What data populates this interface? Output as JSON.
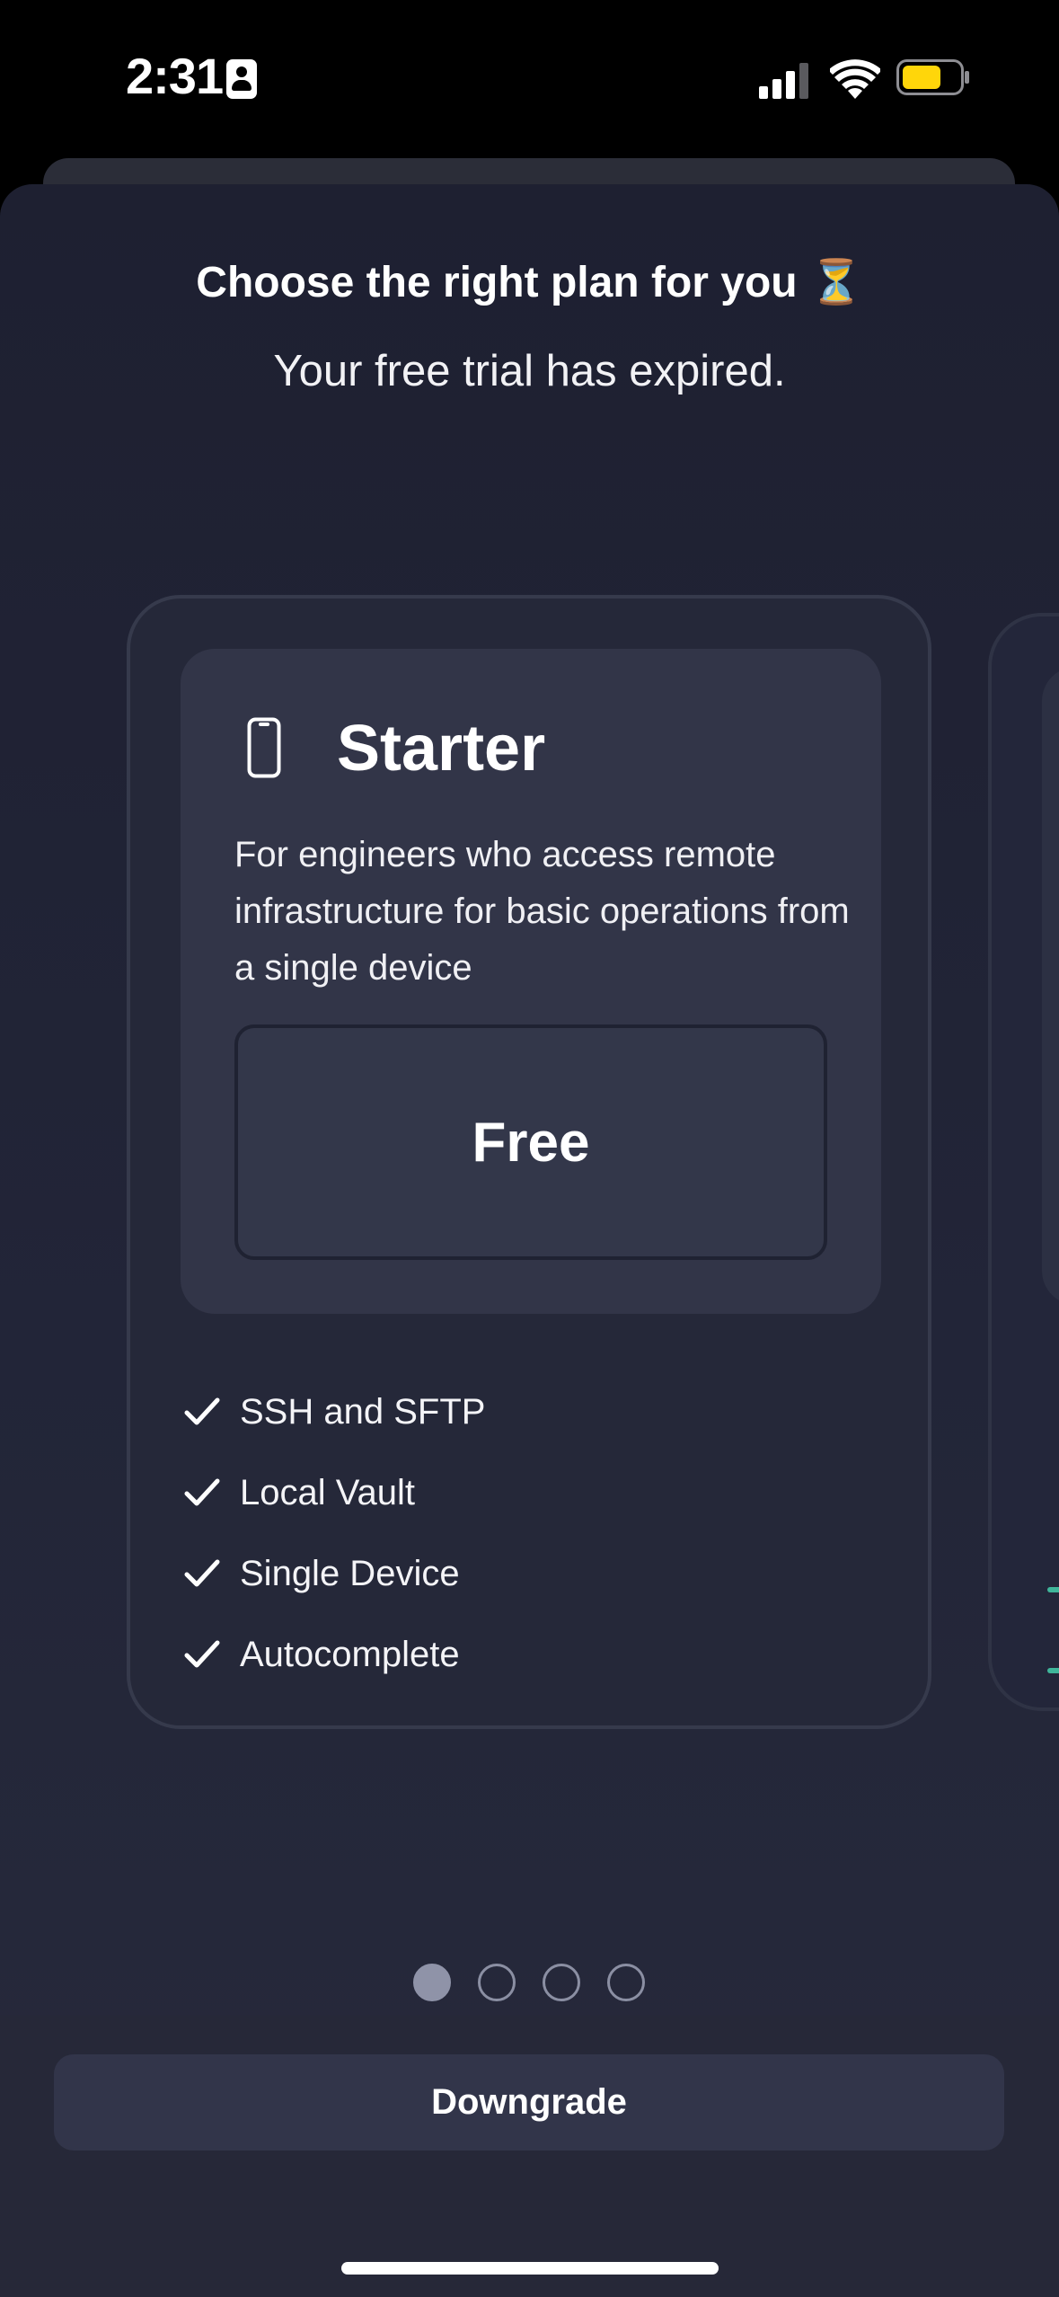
{
  "status_bar": {
    "time": "2:31",
    "icons": [
      "contact-card-icon",
      "cellular-signal-icon",
      "wifi-icon",
      "battery-icon"
    ],
    "battery_color": "#ffd60a"
  },
  "header": {
    "title": "Choose the right plan for you ⏳",
    "subtitle": "Your free trial has expired."
  },
  "plan": {
    "icon": "phone-icon",
    "name": "Starter",
    "description": "For engineers who access remote infrastructure for basic operations from a single device",
    "price": "Free",
    "features": [
      "SSH and SFTP",
      "Local Vault",
      "Single Device",
      "Autocomplete"
    ]
  },
  "pagination": {
    "count": 4,
    "active_index": 0
  },
  "footer": {
    "downgrade_label": "Downgrade"
  },
  "colors": {
    "accent_check": "#3fb59a",
    "background": "#1e2031"
  }
}
